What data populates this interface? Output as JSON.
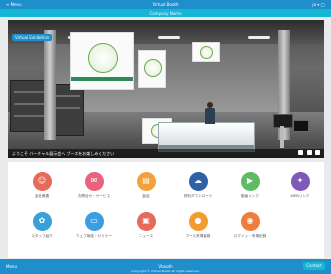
{
  "header": {
    "left_label": "≡ Menu",
    "title": "Virtual Booth",
    "right_label": "ja ▾ ◯",
    "subtitle": "Company Name"
  },
  "scene": {
    "overlay_title": "Virtual Exhibition",
    "caption": "ようこそ バーチャル展示会へ ブースをお楽しみください",
    "controls_label": "Controls"
  },
  "menu": {
    "items": [
      {
        "label": "会社概要",
        "icon": "person-icon",
        "color": "#e86a5c",
        "glyph": "☺"
      },
      {
        "label": "お問合せ・サービス",
        "icon": "mail-icon",
        "color": "#e8637e",
        "glyph": "✉"
      },
      {
        "label": "製品",
        "icon": "document-icon",
        "color": "#f2a13b",
        "glyph": "▤"
      },
      {
        "label": "資料ダウンロード",
        "icon": "download-icon",
        "color": "#2f5fa5",
        "glyph": "☁"
      },
      {
        "label": "動画リンク",
        "icon": "video-icon",
        "color": "#5dbb63",
        "glyph": "▶"
      },
      {
        "label": "WEBリンク",
        "icon": "link-icon",
        "color": "#7d59b8",
        "glyph": "✦"
      },
      {
        "label": "スタッフ紹介",
        "icon": "settings-icon",
        "color": "#3aa0d8",
        "glyph": "✿"
      },
      {
        "label": "ウェブ商談・セミナー",
        "icon": "monitor-icon",
        "color": "#3a9ee0",
        "glyph": "▭"
      },
      {
        "label": "ニュース",
        "icon": "news-icon",
        "color": "#e86a5c",
        "glyph": "▣"
      },
      {
        "label": "ブース来場者数",
        "icon": "pin-icon",
        "color": "#f29b2e",
        "glyph": "●"
      },
      {
        "label": "ログイン・来場記録",
        "icon": "user-circle-icon",
        "color": "#f07d3b",
        "glyph": "◉"
      }
    ]
  },
  "footer": {
    "left_label": "Menu",
    "center_label": "Vbooth",
    "button_label": "Contact",
    "copyright": "Copyright © Virtual Booth All rights reserved."
  }
}
